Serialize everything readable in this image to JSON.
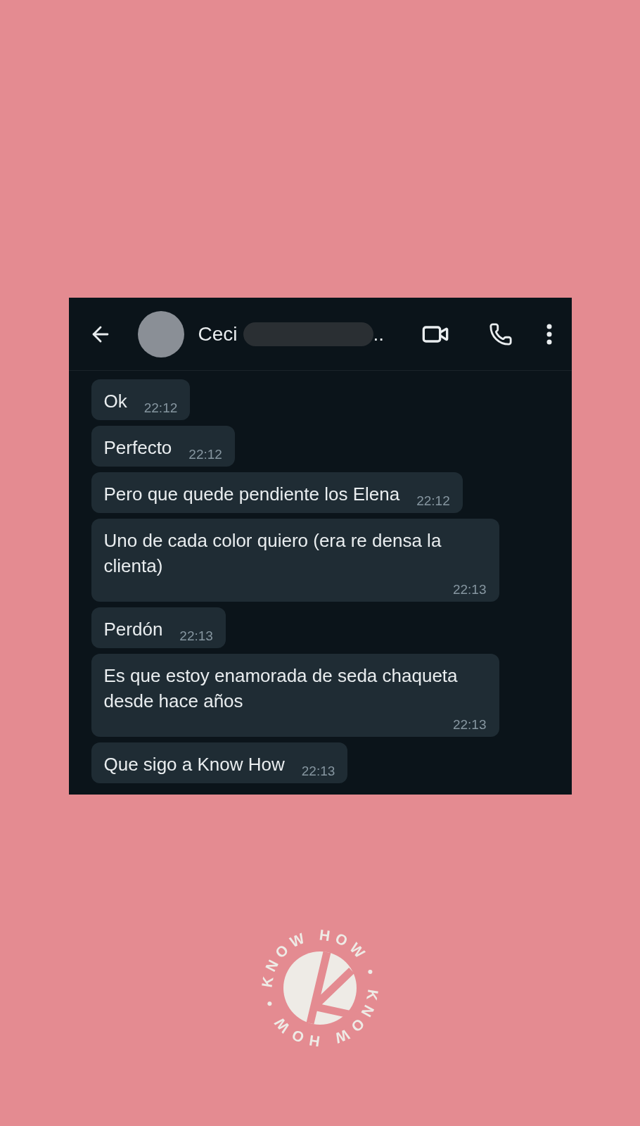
{
  "chat": {
    "contact_name": "Ceci",
    "contact_name_end": "..",
    "messages": [
      {
        "text": "Ok",
        "time": "22:12"
      },
      {
        "text": "Perfecto",
        "time": "22:12"
      },
      {
        "text": "Pero que quede pendiente los Elena",
        "time": "22:12"
      },
      {
        "text": "Uno de cada color quiero (era re densa la clienta)",
        "time": "22:13"
      },
      {
        "text": "Perdón",
        "time": "22:13"
      },
      {
        "text": "Es que estoy enamorada de seda chaqueta desde hace años",
        "time": "22:13"
      },
      {
        "text": "Que sigo a Know How",
        "time": "22:13"
      }
    ]
  },
  "logo": {
    "ring_text": "KNOW HOW • KNOW HOW •"
  }
}
